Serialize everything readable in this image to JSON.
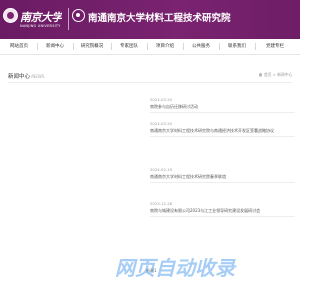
{
  "header": {
    "university_name": "南京大学",
    "university_name_en": "NANJING UNIVERSITY",
    "institute_name": "南通南京大学材料工程技术研究院"
  },
  "nav": {
    "items": [
      {
        "label": "网站首页"
      },
      {
        "label": "新闻中心"
      },
      {
        "label": "研究院概况"
      },
      {
        "label": "专家团队"
      },
      {
        "label": "项目介绍"
      },
      {
        "label": "公共服务"
      },
      {
        "label": "联系我们"
      },
      {
        "label": "党建专栏"
      }
    ]
  },
  "section": {
    "title": "新闻中心",
    "title_en": "NEWS",
    "breadcrumb": "首页 > 新闻中心"
  },
  "news": [
    {
      "date": "2024-03-20",
      "title": "南院参与自历迁移研讨活动"
    },
    {
      "date": "2024-03-20",
      "title": "南通南京大学材料工程技术研究院与南通经济技术开发区签署战略协议"
    },
    {
      "date": "2024-02-19",
      "title": "南通南京大学材料工程技术研究院春季联谊"
    },
    {
      "date": "2023-12-28",
      "title": "南院与城建设有限公司2023与江工业领导研究建设发展研讨会"
    }
  ],
  "overlay": {
    "watermark_text": "网页自动收录",
    "footer_fragment": "新闻1"
  },
  "colors": {
    "brand_purple": "#7a2370",
    "watermark_blue": "#3c91ec"
  }
}
